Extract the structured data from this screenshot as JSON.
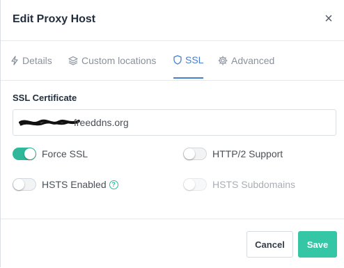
{
  "modal": {
    "title": "Edit Proxy Host",
    "close_symbol": "×"
  },
  "tabs": [
    {
      "label": "Details",
      "icon": "bolt-icon",
      "active": false
    },
    {
      "label": "Custom locations",
      "icon": "layers-icon",
      "active": false
    },
    {
      "label": "SSL",
      "icon": "shield-icon",
      "active": true
    },
    {
      "label": "Advanced",
      "icon": "gear-icon",
      "active": false
    }
  ],
  "ssl": {
    "certificate_label": "SSL Certificate",
    "certificate_value": "freeddns.org",
    "options": {
      "force_ssl": {
        "label": "Force SSL",
        "enabled": true
      },
      "http2": {
        "label": "HTTP/2 Support",
        "enabled": false
      },
      "hsts": {
        "label": "HSTS Enabled",
        "enabled": false,
        "help_symbol": "?"
      },
      "hsts_subdomains": {
        "label": "HSTS Subdomains",
        "enabled": false,
        "disabled": true
      }
    }
  },
  "footer": {
    "cancel_label": "Cancel",
    "save_label": "Save"
  },
  "colors": {
    "accent": "#467fcf",
    "success": "#34c6a5",
    "toggle_on": "#2fb89a"
  }
}
